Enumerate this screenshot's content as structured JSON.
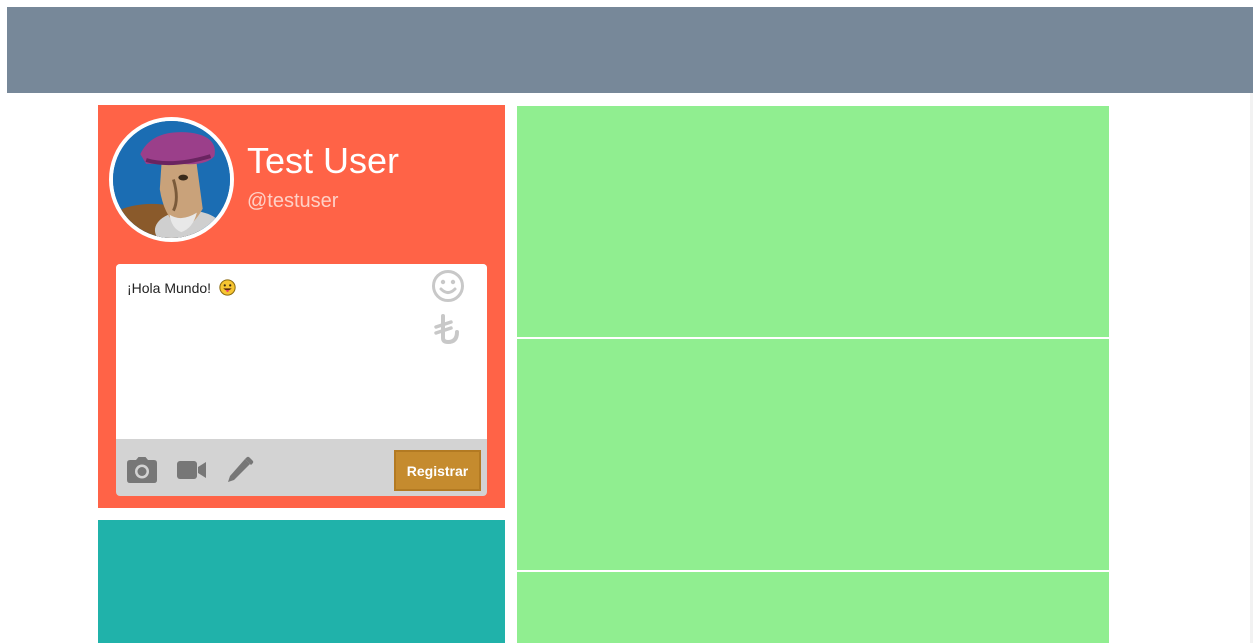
{
  "profile": {
    "name": "Test User",
    "handle": "@testuser",
    "avatar_icon": "avatar-illustration"
  },
  "composer": {
    "text": "¡Hola Mundo!",
    "inline_emoji": "tongue-out-emoji",
    "side_icons": [
      "smiley-icon",
      "lira-icon"
    ],
    "toolbar_icons": [
      "camera-icon",
      "video-camera-icon",
      "pencil-icon"
    ],
    "submit_label": "Registrar"
  },
  "colors": {
    "header": "#778899",
    "profile_card": "#ff6347",
    "teal_panel": "#20b2aa",
    "green_panel": "#90ee90",
    "submit_button": "#c58b2e",
    "composer_toolbar": "#d3d3d3",
    "icon_gray": "#777777",
    "side_icon_gray": "#c8c8c8"
  }
}
